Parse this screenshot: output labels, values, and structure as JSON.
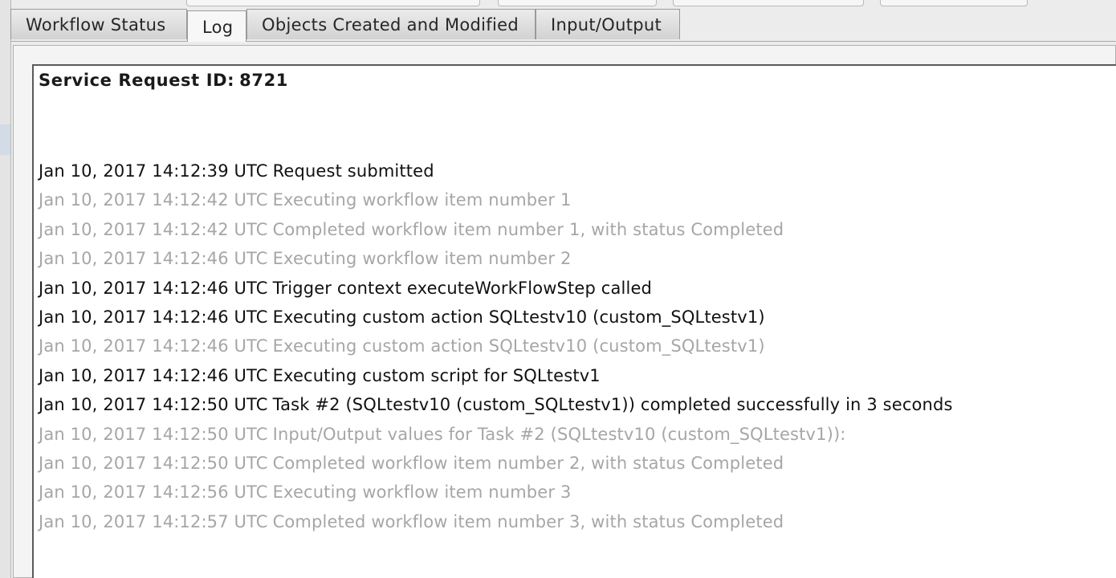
{
  "tabs": [
    {
      "label": "Workflow Status",
      "active": false
    },
    {
      "label": "Log",
      "active": true
    },
    {
      "label": "Objects Created and Modified",
      "active": false
    },
    {
      "label": "Input/Output",
      "active": false
    }
  ],
  "log": {
    "title_label": "Service Request ID:",
    "request_id": "8721",
    "entries": [
      {
        "timestamp": "Jan 10, 2017 14:12:39 UTC",
        "message": "Request submitted",
        "emphasis": "dark"
      },
      {
        "timestamp": "Jan 10, 2017 14:12:42 UTC",
        "message": "Executing workflow item number 1",
        "emphasis": "dim"
      },
      {
        "timestamp": "Jan 10, 2017 14:12:42 UTC",
        "message": "Completed workflow item number 1, with status Completed",
        "emphasis": "dim"
      },
      {
        "timestamp": "Jan 10, 2017 14:12:46 UTC",
        "message": "Executing workflow item number 2",
        "emphasis": "dim"
      },
      {
        "timestamp": "Jan 10, 2017 14:12:46 UTC",
        "message": "Trigger context executeWorkFlowStep called",
        "emphasis": "dark"
      },
      {
        "timestamp": "Jan 10, 2017 14:12:46 UTC",
        "message": "Executing custom action SQLtestv10 (custom_SQLtestv1)",
        "emphasis": "dark"
      },
      {
        "timestamp": "Jan 10, 2017 14:12:46 UTC",
        "message": "Executing custom action SQLtestv10 (custom_SQLtestv1)",
        "emphasis": "dim"
      },
      {
        "timestamp": "Jan 10, 2017 14:12:46 UTC",
        "message": "Executing custom script for SQLtestv1",
        "emphasis": "dark"
      },
      {
        "timestamp": "Jan 10, 2017 14:12:50 UTC",
        "message": "Task #2 (SQLtestv10 (custom_SQLtestv1)) completed successfully in 3 seconds",
        "emphasis": "dark"
      },
      {
        "timestamp": "Jan 10, 2017 14:12:50 UTC",
        "message": "Input/Output values for Task #2 (SQLtestv10 (custom_SQLtestv1)):",
        "emphasis": "dim"
      },
      {
        "timestamp": "Jan 10, 2017 14:12:50 UTC",
        "message": "Completed workflow item number 2, with status Completed",
        "emphasis": "dim"
      },
      {
        "timestamp": "Jan 10, 2017 14:12:56 UTC",
        "message": "Executing workflow item number 3",
        "emphasis": "dim"
      },
      {
        "timestamp": "Jan 10, 2017 14:12:57 UTC",
        "message": "Completed workflow item number 3, with status Completed",
        "emphasis": "dim"
      }
    ]
  },
  "colors": {
    "text_dark": "#111111",
    "text_dim": "#a6a6a6",
    "tab_bg": "#d8d8d8",
    "tab_active_bg": "#f7f7f7",
    "window_bg": "#ececec"
  }
}
